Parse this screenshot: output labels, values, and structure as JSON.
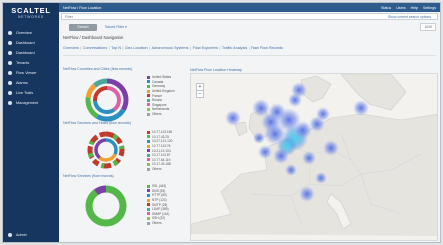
{
  "brand": {
    "name": "SCALTEL",
    "sub": "NETWORKS"
  },
  "sidebar": {
    "items": [
      {
        "label": "Overview"
      },
      {
        "label": "Dashboard"
      },
      {
        "label": "Dashboard"
      },
      {
        "label": "Tenants"
      },
      {
        "label": "Flow Viewer"
      },
      {
        "label": "Alarms"
      },
      {
        "label": "Live Trails"
      },
      {
        "label": "Management"
      }
    ],
    "bottom_label": "Admin"
  },
  "topbar": {
    "breadcrumb": "NetFlow / Flow Location",
    "links": [
      "Status",
      "Users",
      "Help",
      "Settings"
    ]
  },
  "search": {
    "value": "",
    "placeholder": "Filter",
    "filter_link": "Show current search options"
  },
  "actions": {
    "search_label": "Search",
    "saved_label": "Saved Filter ▾",
    "count": "1000"
  },
  "section_title": "NetFlow / Dashboard Navigation",
  "tabs": [
    "Overview",
    "Conversations",
    "Top N",
    "Geo Location",
    "Autonomous Systems",
    "Flow Exporters",
    "Traffic Analysis",
    "Raw Flow Records"
  ],
  "charts": [
    {
      "title": "NetFlow Countries and Cities (flow records)",
      "legend": [
        "United States",
        "Canada",
        "Germany",
        "United Kingdom",
        "France",
        "Russia",
        "Singapore",
        "Netherlands",
        "Others"
      ]
    },
    {
      "title": "NetFlow Services and Hosts (flow records)",
      "legend": [
        "10.77.113.165",
        "10.17.43.25",
        "10.27.121.120",
        "10.77.113.76",
        "10.21.12.103",
        "10.17.113.87",
        "10.77.64.119",
        "10.17.43.188",
        "Others"
      ]
    },
    {
      "title": "NetFlow Services (flow records)",
      "legend": [
        "SSL (443)",
        "DNS (53)",
        "HTTP (80)",
        "NTP (123)",
        "SMTP (25)",
        "LDAP (389)",
        "SNMP (161)",
        "SSH (22)",
        "Others"
      ]
    }
  ],
  "map": {
    "title": "NetFlow Flow Location Heatmap",
    "zoom_in": "+",
    "zoom_out": "−"
  },
  "colors": {
    "sidebar": "#17365f",
    "accent": "#2e5c8d",
    "link": "#3f6fa6",
    "heat": "#5b7be0",
    "heat_core": "#36c3e8",
    "palette": [
      "#7c3fa6",
      "#2d8fc1",
      "#53b847",
      "#f0a030",
      "#c0392b",
      "#48a89a",
      "#e05ea5",
      "#8bc34a",
      "#9aa3ac"
    ]
  }
}
